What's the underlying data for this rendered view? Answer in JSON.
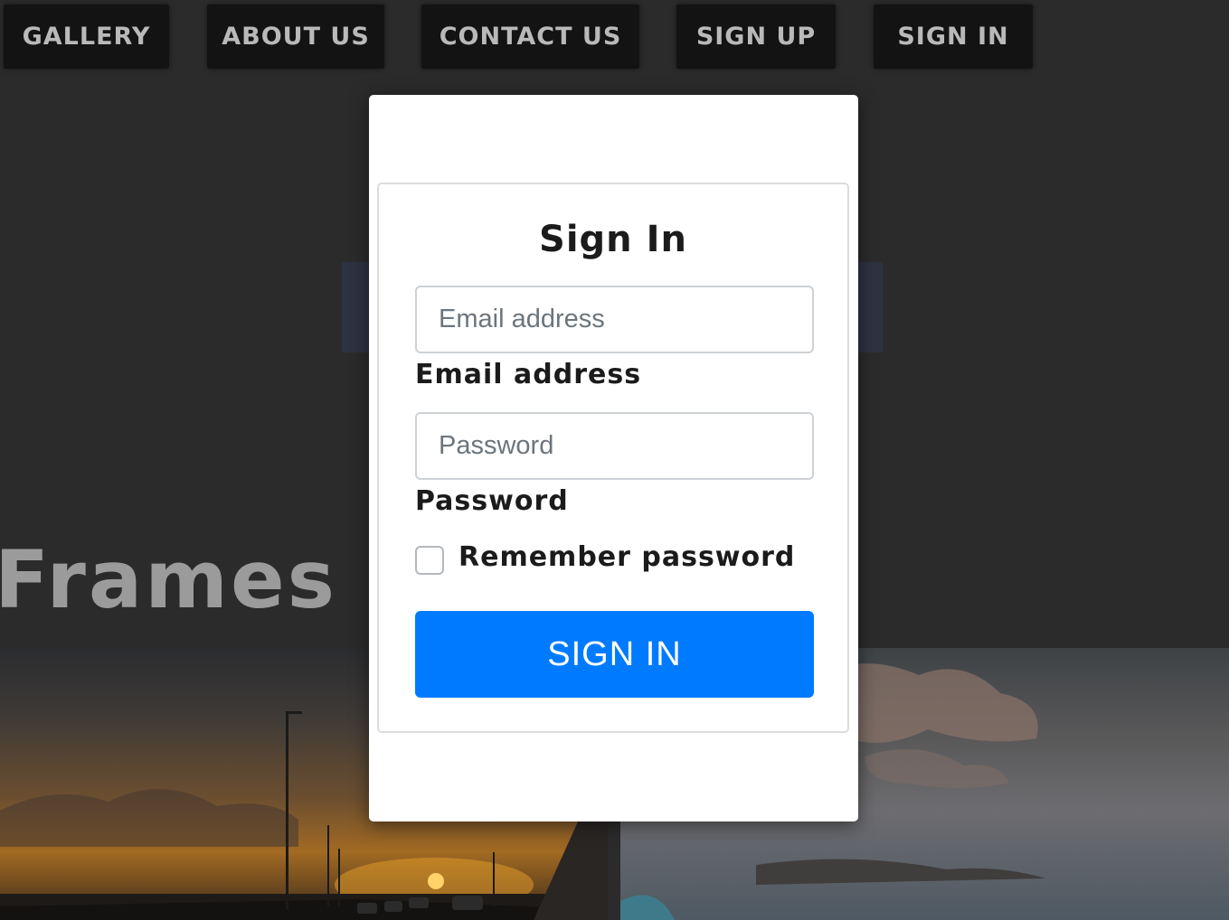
{
  "nav": {
    "items": [
      {
        "label": "GALLERY"
      },
      {
        "label": "ABOUT US"
      },
      {
        "label": "CONTACT US"
      },
      {
        "label": "SIGN UP"
      },
      {
        "label": "SIGN IN"
      }
    ]
  },
  "hero": {
    "title": "Frames G"
  },
  "modal": {
    "title": "Sign In",
    "email": {
      "placeholder": "Email address",
      "value": "",
      "label": "Email address"
    },
    "password": {
      "placeholder": "Password",
      "value": "",
      "label": "Password"
    },
    "remember": {
      "label": "Remember password",
      "checked": false
    },
    "submit_label": "SIGN IN",
    "accent_color": "#007bff"
  }
}
